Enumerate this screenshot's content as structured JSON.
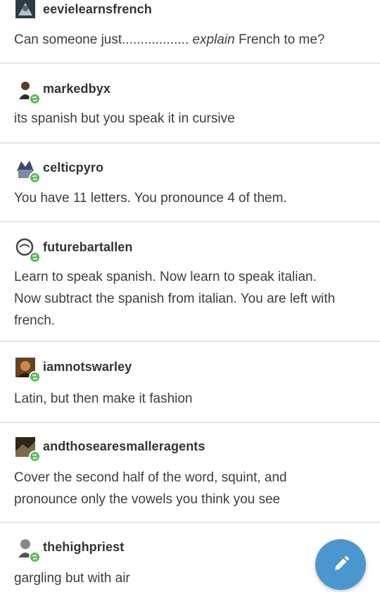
{
  "posts": [
    {
      "username": "eevielearnsfrench",
      "text_before": "Can someone just.................. ",
      "text_em": "explain",
      "text_after": " French to me?"
    },
    {
      "username": "markedbyx",
      "text": "its spanish but you speak it in cursive"
    },
    {
      "username": "celticpyro",
      "text": "You have 11 letters. You pronounce 4 of them."
    },
    {
      "username": "futurebartallen",
      "lines": [
        "Learn to speak spanish. Now learn to speak italian.",
        "Now subtract the spanish from italian. You are left with",
        "french."
      ]
    },
    {
      "username": "iamnotswarley",
      "text": "Latin, but then make it fashion"
    },
    {
      "username": "andthosearesmalleragents",
      "lines": [
        "Cover the second half of the word, squint, and",
        "pronounce only the vowels you think you see"
      ]
    },
    {
      "username": "thehighpriest",
      "text": "gargling but with air"
    }
  ],
  "icons": {
    "reblog_badge": "reblog-icon",
    "fab": "pencil-icon"
  },
  "colors": {
    "reblog_badge": "#5cb85c",
    "fab": "#4a97d0",
    "divider": "#e6e6e6"
  }
}
